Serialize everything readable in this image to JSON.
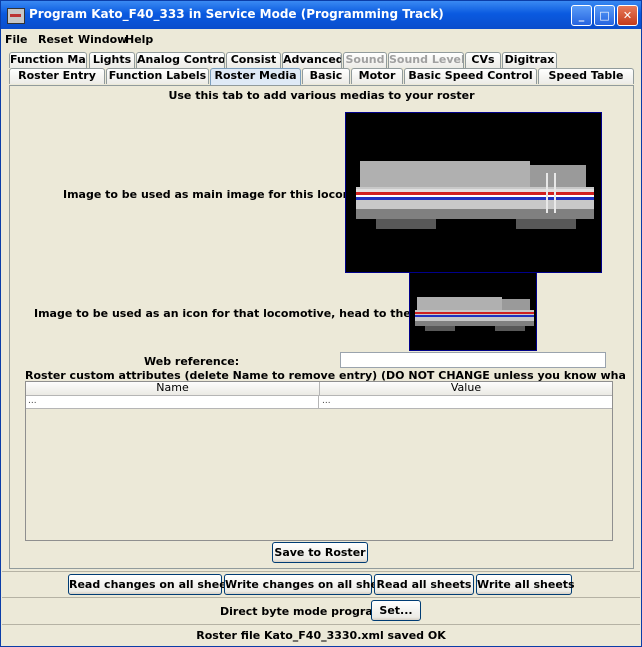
{
  "window": {
    "title": "Program Kato_F40_333 in Service Mode (Programming Track)",
    "app_icon": "locomotive-icon",
    "controls": [
      "minimize-icon",
      "maximize-icon",
      "close-icon"
    ]
  },
  "menubar": {
    "items": [
      "File",
      "Reset",
      "Window",
      "Help"
    ]
  },
  "tabs_row1": [
    {
      "label": "Function Map",
      "enabled": true
    },
    {
      "label": "Lights",
      "enabled": true
    },
    {
      "label": "Analog Controls",
      "enabled": true
    },
    {
      "label": "Consist",
      "enabled": true
    },
    {
      "label": "Advanced",
      "enabled": true
    },
    {
      "label": "Sound",
      "enabled": false
    },
    {
      "label": "Sound Levels",
      "enabled": false
    },
    {
      "label": "CVs",
      "enabled": true
    },
    {
      "label": "Digitrax",
      "enabled": true
    }
  ],
  "tabs_row2": [
    {
      "label": "Roster Entry"
    },
    {
      "label": "Function Labels"
    },
    {
      "label": "Roster Media",
      "selected": true
    },
    {
      "label": "Basic"
    },
    {
      "label": "Motor"
    },
    {
      "label": "Basic Speed Control"
    },
    {
      "label": "Speed Table"
    }
  ],
  "media": {
    "heading": "Use this tab to add various medias to your roster",
    "main_image_label": "Image to be used as main image for this locomotive:",
    "icon_image_label": "Image to be used as an icon for that locomotive, head to the right:",
    "web_reference_label": "Web reference:",
    "web_reference_value": "",
    "attributes_label": "Roster custom attributes (delete Name to remove entry) (DO NOT CHANGE unless you know what you're doing)",
    "attributes_columns": [
      "Name",
      "Value"
    ],
    "attributes_rows": [
      [
        "...",
        "..."
      ]
    ],
    "save_button": "Save to Roster"
  },
  "bottom": {
    "buttons": [
      "Read changes on all sheets",
      "Write changes on all sheets",
      "Read all sheets",
      "Write all sheets"
    ],
    "mode_label": "Direct byte mode programming",
    "set_button": "Set...",
    "status": "Roster file Kato_F40_3330.xml saved OK"
  },
  "colors": {
    "title_bar": "#0a5ae0",
    "image_border": "#00008b",
    "panel": "#ece9d8",
    "close_button": "#c43b1c"
  }
}
